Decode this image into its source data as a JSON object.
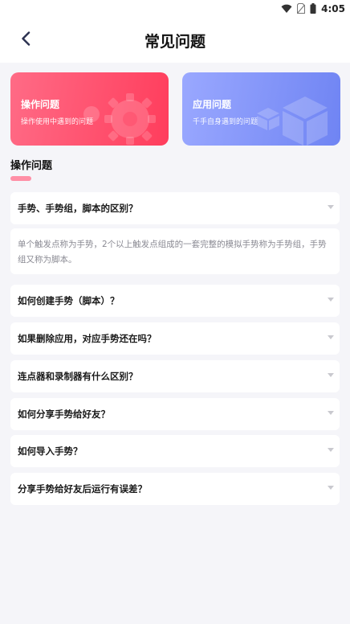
{
  "status_bar": {
    "time": "4:05",
    "icons": [
      "wifi-icon",
      "no-sim-icon",
      "battery-icon"
    ]
  },
  "header": {
    "title": "常见问题",
    "back_icon": "chevron-left-icon"
  },
  "categories": [
    {
      "title": "操作问题",
      "subtitle": "操作使用中遇到的问题",
      "icon": "gear-icon",
      "color_from": "#ff6b86",
      "color_to": "#ff3d5c"
    },
    {
      "title": "应用问题",
      "subtitle": "千手自身遇到的问题",
      "icon": "cube-icon",
      "color_from": "#9aa8ff",
      "color_to": "#6f84f3"
    }
  ],
  "section": {
    "title": "操作问题",
    "accent_color": "#ff8fa6"
  },
  "faqs": [
    {
      "question": "手势、手势组，脚本的区别？",
      "expanded": true,
      "answer": "单个触发点称为手势，2个以上触发点组成的一套完整的模拟手势称为手势组，手势组又称为脚本。"
    },
    {
      "question": "如何创建手势（脚本）？",
      "expanded": false
    },
    {
      "question": "如果删除应用，对应手势还在吗？",
      "expanded": false
    },
    {
      "question": "连点器和录制器有什么区别？",
      "expanded": false
    },
    {
      "question": "如何分享手势给好友？",
      "expanded": false
    },
    {
      "question": "如何导入手势？",
      "expanded": false
    },
    {
      "question": "分享手势给好友后运行有误差？",
      "expanded": false
    }
  ]
}
